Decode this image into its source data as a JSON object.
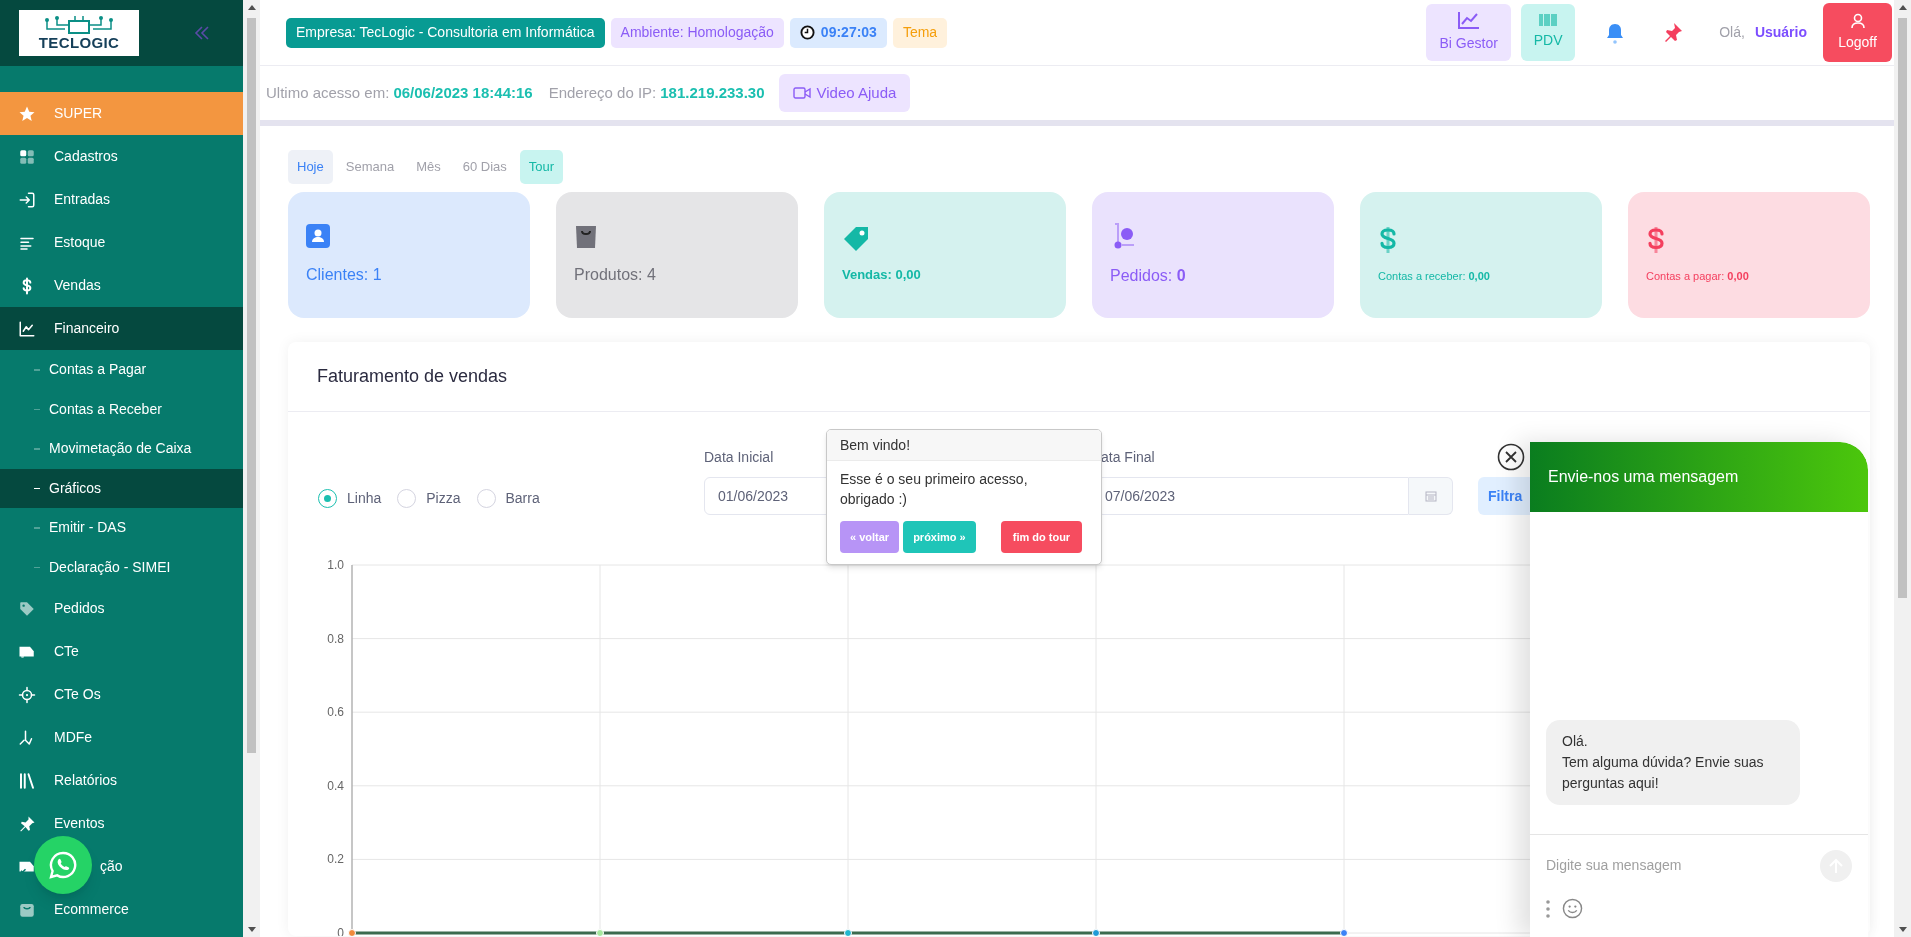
{
  "sidebar": {
    "logo": {
      "text": "TECLOGIC"
    },
    "items": [
      {
        "kind": "featured",
        "label": "SUPER",
        "expanded": false
      },
      {
        "kind": "item",
        "label": "Cadastros",
        "expanded": false
      },
      {
        "kind": "item",
        "label": "Entradas",
        "expanded": false
      },
      {
        "kind": "item",
        "label": "Estoque",
        "expanded": false
      },
      {
        "kind": "item",
        "label": "Vendas",
        "expanded": false
      },
      {
        "kind": "item",
        "label": "Financeiro",
        "expanded": true,
        "children": [
          {
            "label": "Contas a Pagar",
            "selected": false
          },
          {
            "label": "Contas a Receber",
            "selected": false
          },
          {
            "label": "Movimetação de Caixa",
            "selected": false
          },
          {
            "label": "Gráficos",
            "selected": true
          },
          {
            "label": "Emitir - DAS",
            "selected": false
          },
          {
            "label": "Declaração - SIMEI",
            "selected": false
          }
        ]
      },
      {
        "kind": "item",
        "label": "Pedidos",
        "expanded": false
      },
      {
        "kind": "item",
        "label": "CTe",
        "expanded": false
      },
      {
        "kind": "item",
        "label": "CTe Os",
        "expanded": false
      },
      {
        "kind": "item",
        "label": "MDFe",
        "expanded": false
      },
      {
        "kind": "item",
        "label": "Relatórios",
        "expanded": false
      },
      {
        "kind": "item",
        "label": "Eventos",
        "expanded": false
      },
      {
        "kind": "partial",
        "label": "ção",
        "expanded": false
      },
      {
        "kind": "item",
        "label": "Ecommerce",
        "expanded": false
      }
    ]
  },
  "header": {
    "badges": [
      {
        "kind": "company",
        "text": "Empresa: TecLogic - Consultoria em Informática"
      },
      {
        "kind": "environment",
        "text": "Ambiente: Homologação"
      },
      {
        "kind": "clock",
        "text": "09:27:03"
      },
      {
        "kind": "theme",
        "text": "Tema"
      }
    ],
    "buttons": [
      {
        "kind": "bi",
        "label": "Bi Gestor"
      },
      {
        "kind": "pdv",
        "label": "PDV"
      }
    ],
    "greeting": "Olá,",
    "user": "Usuário",
    "logoff": "Logoff"
  },
  "access_bar": {
    "last_access_label": "Ultimo acesso em:",
    "last_access": "06/06/2023 18:44:16",
    "ip_label": "Endereço do IP:",
    "ip": "181.219.233.30",
    "video_help": "Video Ajuda"
  },
  "period_tabs": [
    {
      "label": "Hoje",
      "selected": true
    },
    {
      "label": "Semana",
      "selected": false
    },
    {
      "label": "Mês",
      "selected": false
    },
    {
      "label": "60 Dias",
      "selected": false
    }
  ],
  "tour_button": "Tour",
  "cards": [
    {
      "kind": "user",
      "label": "Clientes: 1",
      "color": "#3b82f6"
    },
    {
      "kind": "bag",
      "label": "Produtos: 4",
      "color": "#71717a"
    },
    {
      "kind": "tag",
      "label": "Vendas: **0,00**",
      "color": "#14b8a6"
    },
    {
      "kind": "dolly",
      "label": "Pedidos: **0**",
      "color": "#8b5cf6"
    },
    {
      "kind": "dollar",
      "label": "Contas a receber: **0,00**",
      "color": "#14b8a6"
    },
    {
      "kind": "dollar",
      "label": "Contas a pagar: **0,00**",
      "color": "#f43f5e"
    }
  ],
  "sales_panel": {
    "title": "Faturamento de vendas",
    "chart_types": [
      {
        "label": "Linha",
        "selected": true
      },
      {
        "label": "Pizza",
        "selected": false
      },
      {
        "label": "Barra",
        "selected": false
      }
    ],
    "start_date": {
      "label": "Data Inicial",
      "value": "01/06/2023"
    },
    "end_date": {
      "label": "ata Final",
      "value": "07/06/2023"
    },
    "filter_button": "Filtra",
    "chart_data": {
      "type": "line",
      "grid": true,
      "marker": true,
      "ylim": [
        0,
        1
      ],
      "yticks": [
        0,
        0.2,
        0.4,
        0.6,
        0.8,
        {
          "value": 1,
          "label": "1.0"
        }
      ],
      "values": [
        0,
        0,
        0,
        0,
        0,
        null,
        null
      ]
    }
  },
  "tour_popup": {
    "title": "Bem vindo!",
    "text": "Esse é o seu primeiro acesso, obrigado :)",
    "buttons": [
      {
        "kind": "back",
        "label": "« voltar"
      },
      {
        "kind": "next",
        "label": "próximo »"
      },
      {
        "kind": "end",
        "label": "fim do tour"
      }
    ]
  },
  "chat": {
    "title": "Envie-nos uma mensagem",
    "message": "Olá.\nTem alguma dúvida? Envie suas perguntas aqui!",
    "placeholder": "Digite sua mensagem"
  }
}
